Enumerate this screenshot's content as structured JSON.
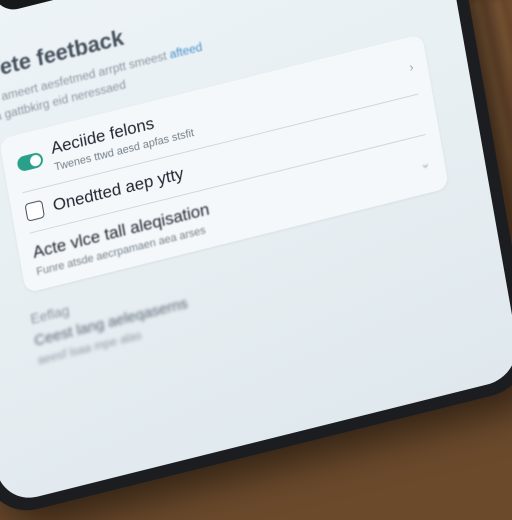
{
  "status_bar": {
    "icons": "▂▄ ◔"
  },
  "header": {
    "title": "Vete feetback",
    "intro_line1": "ir ameert aesfetmed arrptt smeest",
    "intro_link": "afteed",
    "intro_line2": "a gattbkirg eid neressaed"
  },
  "settings": {
    "item1": {
      "title": "Aeciide felons",
      "subtitle": "Twenes ttwd aesd apfas stsfit",
      "toggle_on": true
    },
    "item2": {
      "title": "Onedtted aep ytty",
      "checked": false
    },
    "item3": {
      "title": "Acte vlce tall aleqisation",
      "subtitle": "Funre atsde aecrpamaen aea arses"
    },
    "chevron_icon": "chevron-right-icon"
  },
  "footer": {
    "section_label": "Eeflag",
    "item_title": "Ceest lang aeleqaserns",
    "item_sub": "aeesf lsaa mpe alas"
  }
}
